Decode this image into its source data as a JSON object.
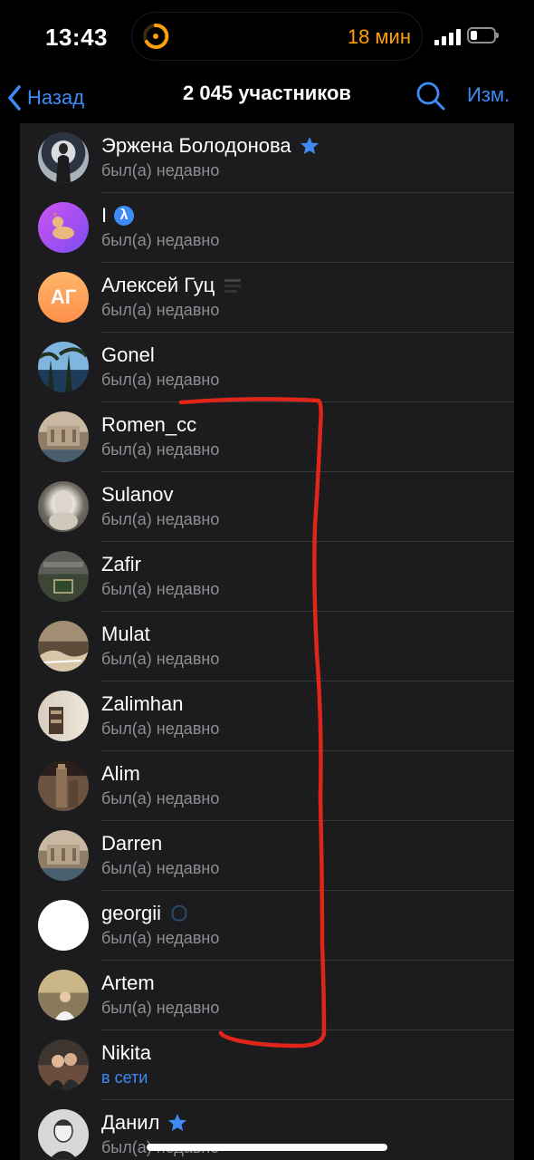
{
  "status_bar": {
    "time": "13:43",
    "timer_text": "18 мин",
    "timer_color": "#ff9f0a",
    "battery_level": 0.3
  },
  "nav": {
    "back_label": "Назад",
    "title": "2 045 участников",
    "search_icon": "magnifier-icon",
    "edit_label": "Изм."
  },
  "members": [
    {
      "name": "Эржена Болодонова",
      "status": "был(а) недавно",
      "badge": "star-icon"
    },
    {
      "name": "I",
      "status": "был(а) недавно",
      "badge": "lambda-icon"
    },
    {
      "name": "Алексей Гуц",
      "status": "был(а) недавно",
      "initials": "АГ",
      "badge": "custom-emoji-icon"
    },
    {
      "name": "Gonel",
      "status": "был(а) недавно"
    },
    {
      "name": "Romen_cc",
      "status": "был(а) недавно"
    },
    {
      "name": "Sulanov",
      "status": "был(а) недавно"
    },
    {
      "name": "Zafir",
      "status": "был(а) недавно"
    },
    {
      "name": "Mulat",
      "status": "был(а) недавно"
    },
    {
      "name": "Zalimhan",
      "status": "был(а) недавно"
    },
    {
      "name": "Alim",
      "status": "был(а) недавно"
    },
    {
      "name": "Darren",
      "status": "был(а) недавно"
    },
    {
      "name": "georgii",
      "status": "был(а) недавно",
      "badge": "custom-emoji-icon"
    },
    {
      "name": "Artem",
      "status": "был(а) недавно"
    },
    {
      "name": "Nikita",
      "status": "в сети"
    },
    {
      "name": "Данил",
      "status": "был(а) недавно",
      "badge": "star-icon"
    }
  ],
  "colors": {
    "accent": "#3e8bf5",
    "list_background": "#1c1c1e",
    "secondary_text": "#8e8e93",
    "annotation": "#e0261b"
  }
}
